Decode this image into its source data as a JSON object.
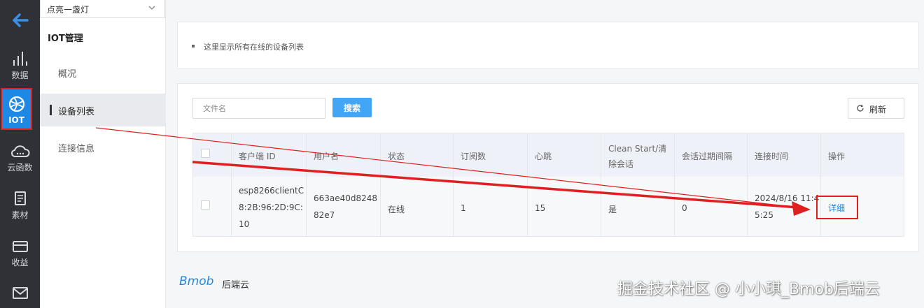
{
  "rail": {
    "items": [
      {
        "label": "",
        "icon": "back-arrow-icon"
      },
      {
        "label": "数据",
        "icon": "bar-chart-icon"
      },
      {
        "label": "IOT",
        "icon": "globe-icon"
      },
      {
        "label": "云函数",
        "icon": "cloud-icon"
      },
      {
        "label": "素材",
        "icon": "document-icon"
      },
      {
        "label": "收益",
        "icon": "card-icon"
      },
      {
        "label": "",
        "icon": "mail-icon"
      }
    ]
  },
  "app_selector": {
    "value": "点亮一盏灯"
  },
  "subnav": {
    "title": "IOT管理",
    "items": [
      {
        "label": "概况"
      },
      {
        "label": "设备列表"
      },
      {
        "label": "连接信息"
      }
    ]
  },
  "notice": {
    "text": "这里显示所有在线的设备列表"
  },
  "toolbar": {
    "search_placeholder": "文件名",
    "search_label": "搜索",
    "refresh_label": "刷新"
  },
  "table": {
    "headers": [
      "客户端 ID",
      "用户名",
      "状态",
      "订阅数",
      "心跳",
      "Clean Start/清",
      "除会话",
      "会话过期间隔",
      "连接时间",
      "操作"
    ],
    "row": {
      "client_id_lines": [
        "esp8266clientC",
        "8:2B:96:2D:9C:",
        "10"
      ],
      "username_lines": [
        "663ae40d8248",
        "82e7"
      ],
      "status": "在线",
      "subscriptions": "1",
      "heartbeat": "15",
      "clean_start": "是",
      "session_expiry": "0",
      "connect_time_lines": [
        "2024/8/16 11:4",
        "5:25"
      ],
      "action": "详细"
    }
  },
  "footer": {
    "logo": "Bmob",
    "logo_sub": "后端云"
  },
  "watermark": "掘金技术社区 @ 小小琪_Bmob后端云",
  "colors": {
    "accent": "#1e88e5",
    "highlight": "#e02020",
    "rail_bg": "#2f3136"
  }
}
